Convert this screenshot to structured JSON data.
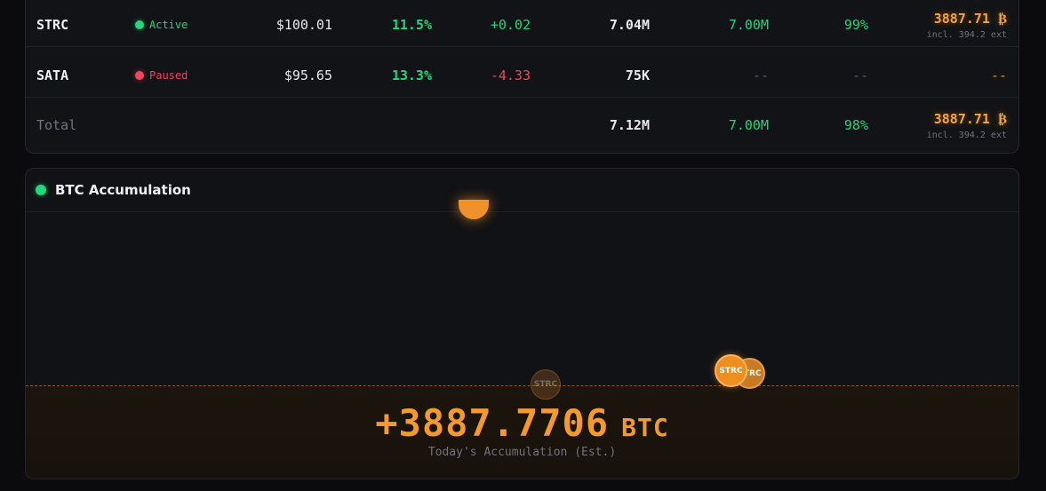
{
  "table": {
    "rows": [
      {
        "name": "STRC",
        "status": "Active",
        "status_color": "green",
        "price": "$100.01",
        "yield": "11.5%",
        "change": "+0.02",
        "volume": "7.04M",
        "cap": "7.00M",
        "pct": "99%",
        "btc": "3887.71 ₿",
        "btc_note": "incl. 394.2 ext"
      },
      {
        "name": "SATA",
        "status": "Paused",
        "status_color": "red",
        "price": "$95.65",
        "yield": "13.3%",
        "change": "-4.33",
        "volume": "75K",
        "cap": "--",
        "pct": "--",
        "btc": "--"
      }
    ],
    "total": {
      "label": "Total",
      "volume": "7.12M",
      "cap": "7.00M",
      "pct": "98%",
      "btc": "3887.71 ₿",
      "btc_note": "incl. 394.2 ext"
    }
  },
  "chart": {
    "title": "BTC Accumulation",
    "coins": {
      "faded": "STRC",
      "back": "STRC",
      "front": "STRC"
    },
    "total_value": "+3887.7706",
    "total_unit": "BTC",
    "caption": "Today's Accumulation (Est.)"
  },
  "colors": {
    "green": "#22d67a",
    "red": "#f2455a",
    "orange": "#f0922b",
    "background": "#0b0b0d",
    "card": "#121316"
  },
  "icons": {
    "status_dot": "status-dot-icon",
    "coin": "btc-coin-icon"
  }
}
